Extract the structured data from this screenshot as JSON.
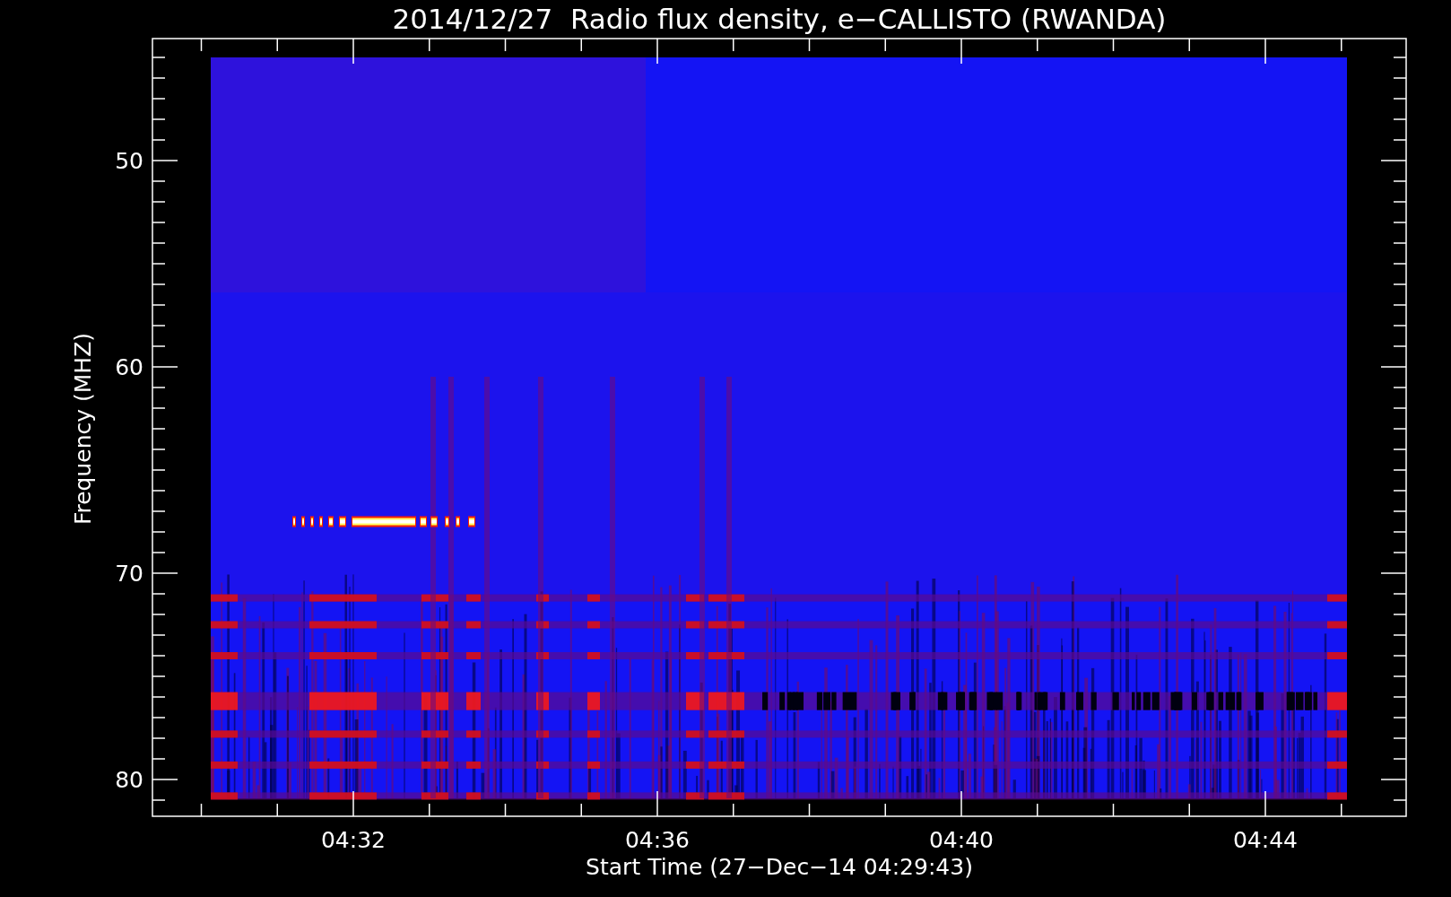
{
  "title": "2014/12/27  Radio flux density, e−CALLISTO (RWANDA)",
  "y_axis": {
    "label": "Frequency (MHZ)",
    "tick_labels": [
      "50",
      "60",
      "70",
      "80"
    ]
  },
  "x_axis": {
    "label": "Start Time (27−Dec−14 04:29:43)",
    "tick_labels": [
      "04:32",
      "04:36",
      "04:40",
      "04:44"
    ]
  }
}
